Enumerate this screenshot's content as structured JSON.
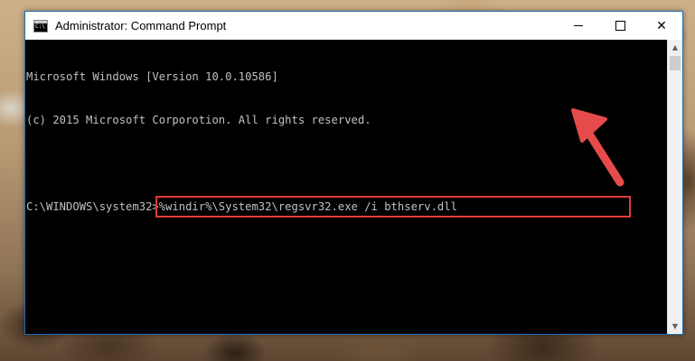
{
  "window": {
    "title": "Administrator: Command Prompt",
    "controls": {
      "minimize": "minimize",
      "maximize": "maximize",
      "close": "✕"
    }
  },
  "console": {
    "lines": [
      "Microsoft Windows [Version 10.0.10586]",
      "(c) 2015 Microsoft Corporotion. All rights reserved."
    ],
    "prompt": "C:\\WINDOWS\\system32>",
    "command": "%windir%\\System32\\regsvr32.exe /i bthserv.dll"
  },
  "scrollbar": {
    "up_arrow": "▲",
    "down_arrow": "▼"
  },
  "colors": {
    "highlight_box": "#e23a3a",
    "arrow": "#e54b4b",
    "console_text": "#c0c0c0",
    "console_bg": "#000000"
  },
  "icons": [
    "cmd-app-icon",
    "minimize-icon",
    "maximize-icon",
    "close-icon",
    "scroll-up-icon",
    "scroll-down-icon",
    "pointer-arrow-icon"
  ]
}
